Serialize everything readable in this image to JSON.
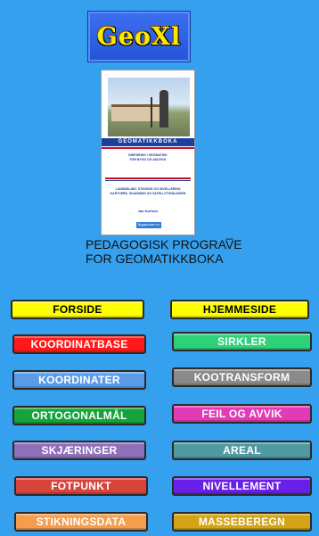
{
  "logo": {
    "text": "GeoXl"
  },
  "book": {
    "title": "GEOMATIKKBOKA",
    "subtitle1": "INNFØRING I GEOMATIKK",
    "subtitle2": "FOR BYGG OG ANLEGG",
    "subtitle3": "LANDMÅLING, STIKKING OG NIVELLERING",
    "subtitle4": "KARTVERK, SKANNING OG SATELLITTMÅLINGER",
    "author": "Jan Karlsen",
    "publisher": "Byggkunden.no"
  },
  "tagline": {
    "line1": "PEDAGOGISK PROGRAV̅E",
    "line2": "FOR GEOMATIKKBOKA"
  },
  "buttons": {
    "forside": "FORSIDE",
    "hjemmeside": "HJEMMESIDE",
    "koordinatbase": "KOORDINATBASE",
    "sirkler": "SIRKLER",
    "koordinater": "KOORDINATER",
    "kootransform": "KOOTRANSFORM",
    "ortogonalmal": "ORTOGONALMÅL",
    "feil_og_avvik": "FEIL OG AVVIK",
    "skjaeringer": "SKJÆRINGER",
    "areal": "AREAL",
    "fotpunkt": "FOTPUNKT",
    "nivellement": "NIVELLEMENT",
    "stikningsdata": "STIKNINGSDATA",
    "masseberegn": "MASSEBEREGN"
  },
  "colors": {
    "background": "#35a0ee",
    "forside": "#ffff00",
    "hjemmeside": "#ffff00",
    "koordinatbase": "#ff1a1a",
    "sirkler": "#2fd07a",
    "koordinater": "#5a9be8",
    "kootransform": "#8a8a8a",
    "ortogonalmal": "#16a33a",
    "feil_og_avvik": "#e23bb5",
    "skjaeringer": "#8e6fb8",
    "areal": "#4f9aa0",
    "fotpunkt": "#d8443c",
    "nivellement": "#6a1fe8",
    "stikningsdata": "#f59d4d",
    "masseberegn": "#d4a316"
  }
}
